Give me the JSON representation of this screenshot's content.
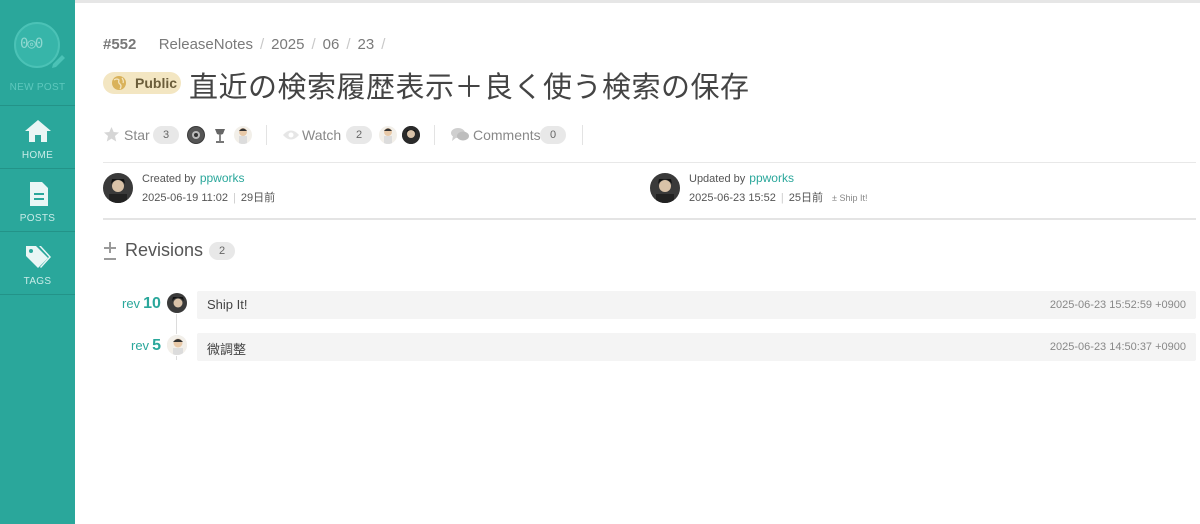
{
  "sidebar": {
    "new_post_label": "NEW POST",
    "items": [
      {
        "label": "HOME",
        "icon": "home-icon"
      },
      {
        "label": "POSTS",
        "icon": "document-icon"
      },
      {
        "label": "TAGS",
        "icon": "tags-icon"
      }
    ]
  },
  "breadcrumb": {
    "number": "#552",
    "items": [
      "ReleaseNotes",
      "2025",
      "06",
      "23"
    ]
  },
  "post": {
    "visibility": "Public",
    "title": "直近の検索履歴表示＋良く使う検索の保存"
  },
  "actions": {
    "star": {
      "label": "Star",
      "count": "3"
    },
    "watch": {
      "label": "Watch",
      "count": "2"
    },
    "comments": {
      "label": "Comments",
      "count": "0"
    }
  },
  "meta": {
    "created": {
      "prefix": "Created by",
      "user": "ppworks",
      "datetime": "2025-06-19 11:02",
      "relative": "29日前"
    },
    "updated": {
      "prefix": "Updated by",
      "user": "ppworks",
      "datetime": "2025-06-23 15:52",
      "relative": "25日前",
      "message": "Ship It!"
    }
  },
  "revisions": {
    "title": "Revisions",
    "count": "2",
    "items": [
      {
        "rev_prefix": "rev",
        "rev_number": "10",
        "message": "Ship It!",
        "timestamp": "2025-06-23 15:52:59 +0900"
      },
      {
        "rev_prefix": "rev",
        "rev_number": "5",
        "message": "微調整",
        "timestamp": "2025-06-23 14:50:37 +0900"
      }
    ]
  },
  "colors": {
    "accent": "#2aa79b",
    "sidebar": "#2aa79b",
    "badge_bg": "#f3e6c2"
  }
}
